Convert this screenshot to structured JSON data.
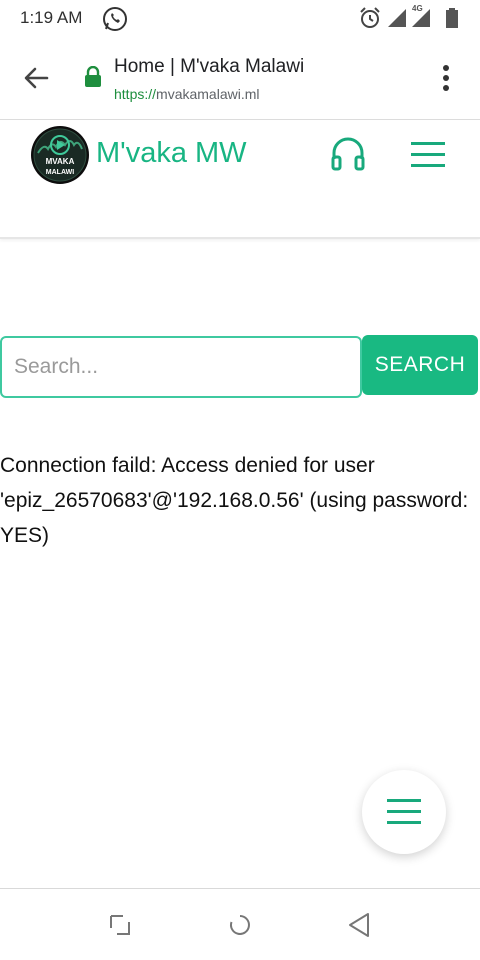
{
  "status_bar": {
    "time": "1:19 AM",
    "network_label": "4G",
    "icons": [
      "whatsapp-icon",
      "alarm-icon",
      "signal-icon",
      "battery-icon"
    ]
  },
  "browser": {
    "title": "Home | M'vaka Malawi",
    "url_scheme": "https://",
    "url_host": "mvakamalawi.ml",
    "icons": [
      "back-arrow-icon",
      "lock-icon",
      "more-vert-icon"
    ]
  },
  "site": {
    "name": "M'vaka MW",
    "logo_line1": "MVAKA",
    "logo_line2": "MALAWI",
    "icons": [
      "headphones-icon",
      "hamburger-menu-icon"
    ]
  },
  "search": {
    "placeholder": "Search...",
    "value": "",
    "button_label": "SEARCH"
  },
  "message": {
    "error": "Connection faild: Access denied for user 'epiz_26570683'@'192.168.0.56' (using password: YES)"
  },
  "fab": {
    "icon": "hamburger-menu-icon"
  },
  "nav_bar": {
    "icons": [
      "recent-apps-icon",
      "home-circle-icon",
      "back-triangle-icon"
    ]
  },
  "colors": {
    "accent": "#19b982",
    "input_border": "#3fc9a0",
    "site_name": "#18b583",
    "lock_green": "#1e8e3e"
  }
}
